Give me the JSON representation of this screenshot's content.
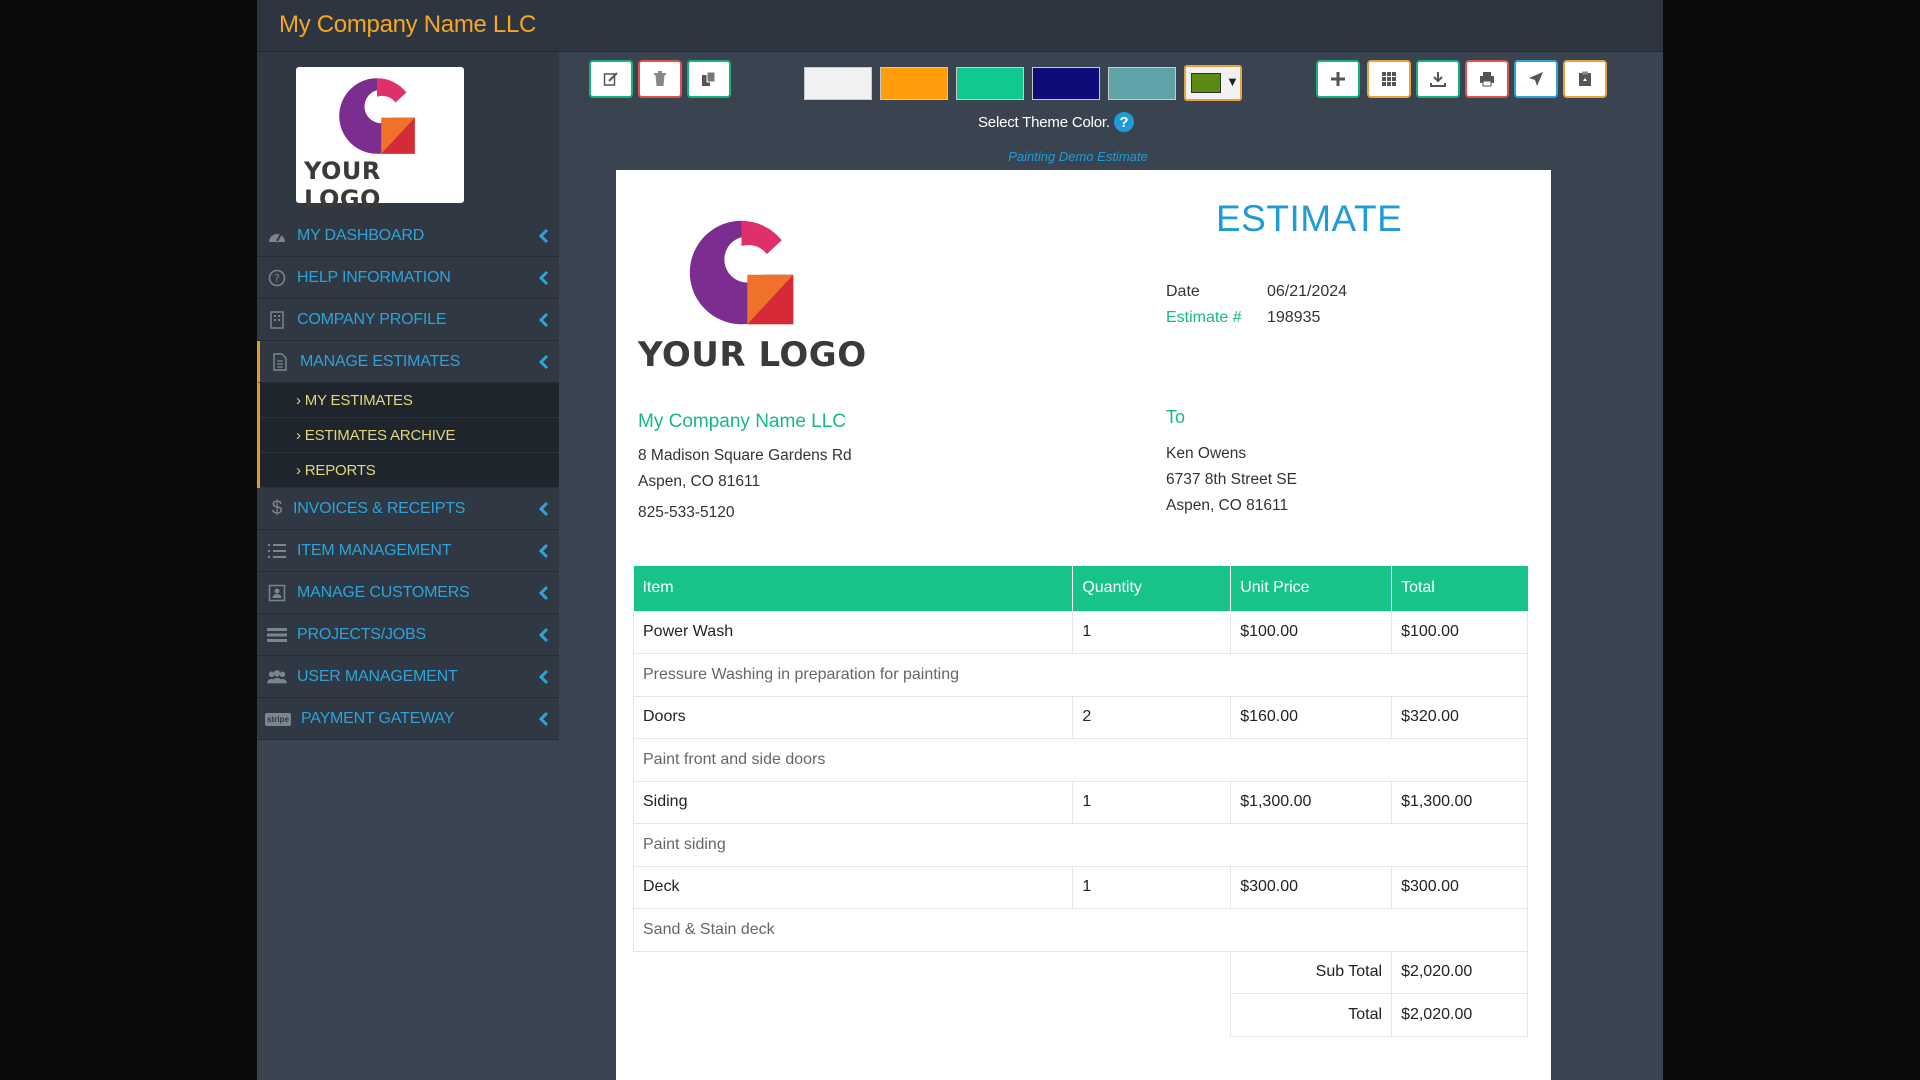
{
  "app": {
    "title": "My Company Name LLC"
  },
  "sidebar": {
    "logo_text": "YOUR LOGO",
    "items": [
      {
        "label": "MY DASHBOARD",
        "icon": "dashboard-icon"
      },
      {
        "label": "HELP INFORMATION",
        "icon": "help-circle-icon"
      },
      {
        "label": "COMPANY PROFILE",
        "icon": "building-icon"
      },
      {
        "label": "MANAGE ESTIMATES",
        "icon": "document-icon"
      },
      {
        "label": "INVOICES & RECEIPTS",
        "icon": "dollar-icon"
      },
      {
        "label": "ITEM MANAGEMENT",
        "icon": "list-icon"
      },
      {
        "label": "MANAGE CUSTOMERS",
        "icon": "contact-card-icon"
      },
      {
        "label": "PROJECTS/JOBS",
        "icon": "server-icon"
      },
      {
        "label": "USER MANAGEMENT",
        "icon": "users-icon"
      },
      {
        "label": "PAYMENT GATEWAY",
        "icon": "stripe-icon"
      }
    ],
    "submenu": [
      "MY ESTIMATES",
      "ESTIMATES ARCHIVE",
      "REPORTS"
    ],
    "stripe_badge": "stripe"
  },
  "toolbar": {
    "left_buttons": [
      "edit-icon",
      "trash-icon",
      "copy-icon"
    ],
    "right_buttons": [
      "plus-icon",
      "grid-icon",
      "download-icon",
      "print-icon",
      "send-icon",
      "clipboard-icon"
    ],
    "swatches": [
      "#f2f2f2",
      "#ff9d0a",
      "#10c98e",
      "#0d0d7a",
      "#5fa3a8"
    ],
    "custom_swatch": "#5a8a12",
    "theme_label": "Select Theme Color.",
    "help_glyph": "?",
    "estimate_name": "Painting Demo Estimate"
  },
  "document": {
    "title": "ESTIMATE",
    "logo_text": "YOUR LOGO",
    "date_label": "Date",
    "date_value": "06/21/2024",
    "estimate_label": "Estimate #",
    "estimate_value": "198935",
    "from": {
      "name": "My Company Name LLC",
      "line1": "8 Madison Square Gardens Rd",
      "line2": "Aspen, CO 81611",
      "phone": "825-533-5120"
    },
    "to": {
      "label": "To",
      "name": "Ken Owens",
      "line1": "6737 8th Street SE",
      "line2": "Aspen, CO 81611"
    },
    "table": {
      "headers": [
        "Item",
        "Quantity",
        "Unit Price",
        "Total"
      ],
      "rows": [
        {
          "item": "Power Wash",
          "qty": "1",
          "price": "$100.00",
          "total": "$100.00",
          "desc": "Pressure Washing in preparation for painting"
        },
        {
          "item": "Doors",
          "qty": "2",
          "price": "$160.00",
          "total": "$320.00",
          "desc": "Paint front and side doors"
        },
        {
          "item": "Siding",
          "qty": "1",
          "price": "$1,300.00",
          "total": "$1,300.00",
          "desc": "Paint siding"
        },
        {
          "item": "Deck",
          "qty": "1",
          "price": "$300.00",
          "total": "$300.00",
          "desc": "Sand & Stain deck"
        }
      ],
      "subtotal_label": "Sub Total",
      "subtotal_value": "$2,020.00",
      "total_label": "Total",
      "total_value": "$2,020.00"
    }
  }
}
